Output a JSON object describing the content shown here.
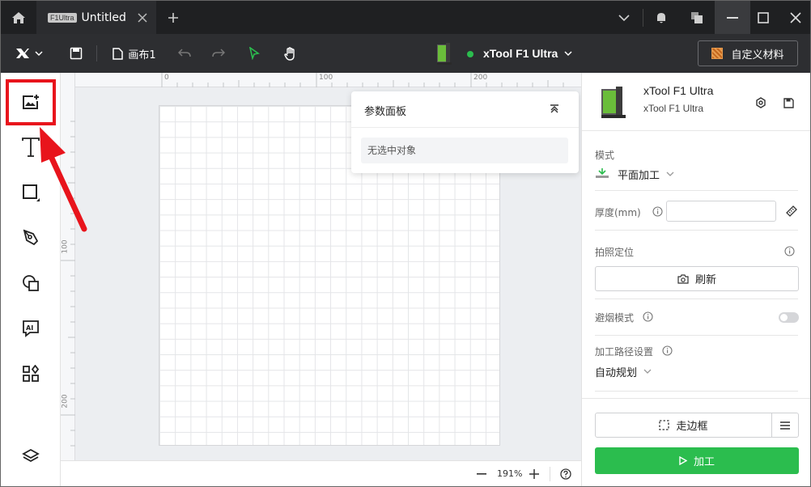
{
  "titlebar": {
    "home_icon": "home-icon",
    "tab": {
      "device_badge": "F1Ultra",
      "title": "Untitled"
    },
    "add_tab": "+"
  },
  "toolbar": {
    "canvas_name": "画布1",
    "device_name": "xTool F1 Ultra",
    "device_status_color": "#2bbd4e",
    "material_label": "自定义材料"
  },
  "canvas": {
    "ruler_h": [
      "0",
      "100",
      "200"
    ],
    "ruler_v": [
      "100",
      "200"
    ],
    "param_panel": {
      "title": "参数面板",
      "empty_text": "无选中对象"
    },
    "zoom": "191%"
  },
  "right_panel": {
    "device_name": "xTool F1 Ultra",
    "device_model": "xTool F1 Ultra",
    "mode_label": "模式",
    "mode_value": "平面加工",
    "thickness_label": "厚度(mm)",
    "thickness_value": "",
    "positioning_label": "拍照定位",
    "refresh_label": "刷新",
    "smoke_label": "避烟模式",
    "path_label": "加工路径设置",
    "path_value": "自动规划",
    "frame_label": "走边框",
    "process_label": "加工"
  },
  "colors": {
    "accent": "#2bbd4e",
    "highlight": "#e8141c"
  }
}
